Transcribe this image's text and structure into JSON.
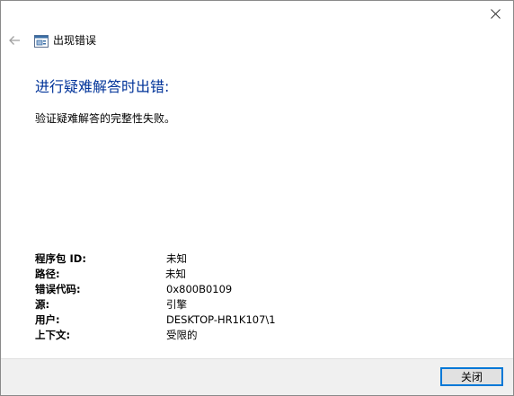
{
  "window": {
    "title": "出现错误",
    "icons": {
      "close": "close-icon",
      "back": "back-arrow-icon",
      "app": "troubleshooter-icon"
    }
  },
  "main": {
    "heading": "进行疑难解答时出错:",
    "message": "验证疑难解答的完整性失败。"
  },
  "details": [
    {
      "label": "程序包 ID:",
      "value": "未知"
    },
    {
      "label": "路径:",
      "value": "未知"
    },
    {
      "label": "错误代码:",
      "value": "0x800B0109"
    },
    {
      "label": "源:",
      "value": "引擎"
    },
    {
      "label": "用户:",
      "value": "DESKTOP-HR1K107\\1"
    },
    {
      "label": "上下文:",
      "value": "受限的"
    }
  ],
  "footer": {
    "close_label": "关闭"
  },
  "colors": {
    "heading": "#003399",
    "footer_bg": "#f0f0f0",
    "button_border": "#0078d7"
  }
}
